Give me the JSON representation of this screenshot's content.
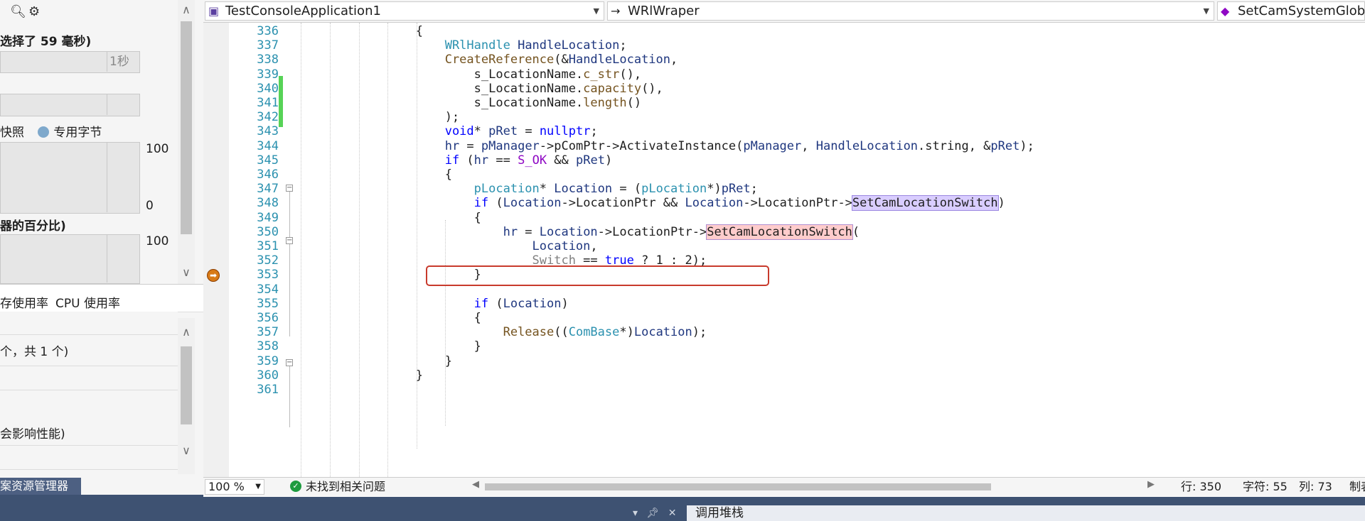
{
  "left_panel": {
    "selection_text": "选择了 59 毫秒)",
    "tick_label": "1秒",
    "legend_snapshot": "快照",
    "legend_private_bytes": "专用字节",
    "mem_axis_top": "100",
    "mem_axis_bottom": "0",
    "cpu_heading": "器的百分比)",
    "cpu_axis_top": "100",
    "tab_memory": "存使用率",
    "tab_cpu": "CPU 使用率",
    "summary_count": "个，共 1 个)",
    "perf_note": "会影响性能)",
    "footer_tab": "案资源管理器"
  },
  "nav": {
    "project": "TestConsoleApplication1",
    "class_scope": "WRlWraper",
    "member": "SetCamSystemGlobalValue(bool Switch)"
  },
  "editor": {
    "line_numbers": [
      "336",
      "337",
      "338",
      "339",
      "340",
      "341",
      "342",
      "343",
      "344",
      "345",
      "346",
      "347",
      "348",
      "349",
      "350",
      "351",
      "352",
      "353",
      "354",
      "355",
      "356",
      "357",
      "358",
      "359",
      "360",
      "361"
    ],
    "current_line": "350"
  },
  "status": {
    "zoom": "100 %",
    "issues": "未找到相关问题",
    "line": "行: 350",
    "char": "字符: 55",
    "col": "列: 73",
    "mode": "制表"
  },
  "bottom": {
    "call_stack_tab": "调用堆栈"
  },
  "colors": {
    "keyword": "#0000ff",
    "type": "#2b91af",
    "function": "#74531f",
    "macro": "#8f08c4",
    "breakpoint_frame": "#c83a2c",
    "change_marker": "#57d357"
  }
}
